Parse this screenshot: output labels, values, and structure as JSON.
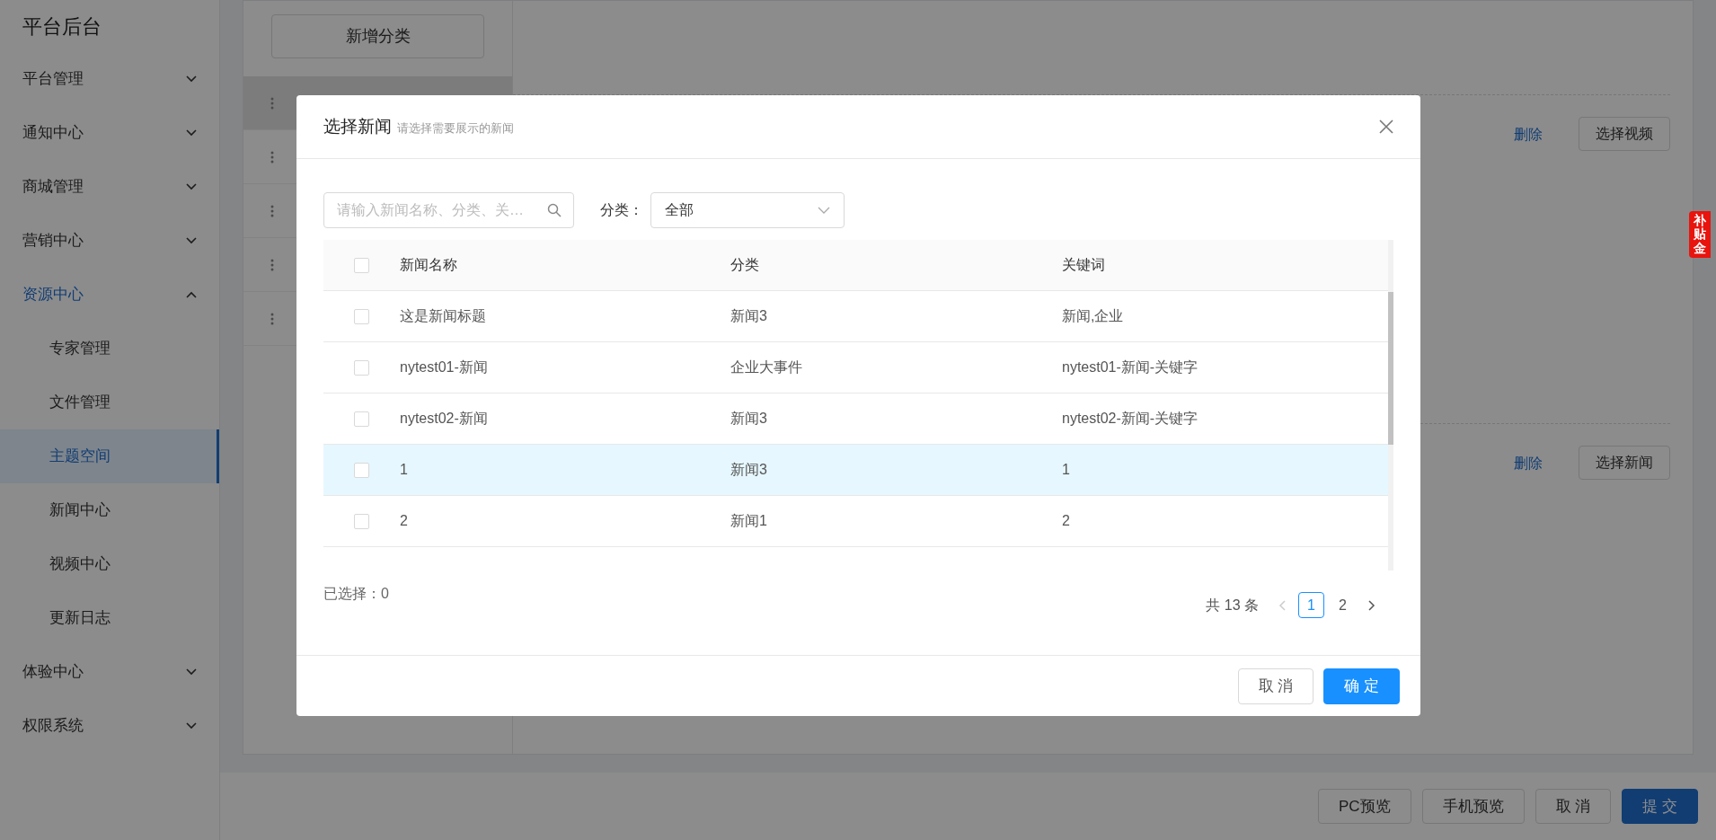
{
  "sidebar": {
    "title": "平台后台",
    "items": [
      {
        "label": "平台管理",
        "expanded": false
      },
      {
        "label": "通知中心",
        "expanded": false
      },
      {
        "label": "商城管理",
        "expanded": false
      },
      {
        "label": "营销中心",
        "expanded": false
      },
      {
        "label": "资源中心",
        "expanded": true,
        "children": [
          {
            "label": "专家管理",
            "selected": false
          },
          {
            "label": "文件管理",
            "selected": false
          },
          {
            "label": "主题空间",
            "selected": true
          },
          {
            "label": "新闻中心",
            "selected": false
          },
          {
            "label": "视频中心",
            "selected": false
          },
          {
            "label": "更新日志",
            "selected": false
          }
        ]
      },
      {
        "label": "体验中心",
        "expanded": false
      },
      {
        "label": "权限系统",
        "expanded": false
      }
    ]
  },
  "category_panel": {
    "add_button": "新增分类",
    "rows": [
      {
        "selected": true
      },
      {
        "selected": false
      },
      {
        "selected": false
      },
      {
        "selected": false
      },
      {
        "selected": false
      }
    ]
  },
  "content_sections": [
    {
      "delete_link": "删除",
      "select_button": "选择视频"
    },
    {
      "delete_link": "删除",
      "select_button": "选择新闻"
    }
  ],
  "footer_buttons": [
    {
      "label": "PC预览",
      "kind": "default"
    },
    {
      "label": "手机预览",
      "kind": "default"
    },
    {
      "label": "取 消",
      "kind": "default"
    },
    {
      "label": "提 交",
      "kind": "primary"
    }
  ],
  "floating_badge": "补贴金",
  "modal": {
    "title": "选择新闻",
    "subtitle": "请选择需要展示的新闻",
    "search": {
      "placeholder": "请输入新闻名称、分类、关…"
    },
    "filter": {
      "label": "分类：",
      "value": "全部"
    },
    "table": {
      "columns": [
        "新闻名称",
        "分类",
        "关键词"
      ],
      "header_checked": false,
      "rows": [
        {
          "cells": [
            "这是新闻标题",
            "新闻3",
            "新闻,企业"
          ],
          "checked": false,
          "highlighted": false
        },
        {
          "cells": [
            "nytest01-新闻",
            "企业大事件",
            "nytest01-新闻-关键字"
          ],
          "checked": false,
          "highlighted": false
        },
        {
          "cells": [
            "nytest02-新闻",
            "新闻3",
            "nytest02-新闻-关键字"
          ],
          "checked": false,
          "highlighted": false
        },
        {
          "cells": [
            "1",
            "新闻3",
            "1"
          ],
          "checked": false,
          "highlighted": true
        },
        {
          "cells": [
            "2",
            "新闻1",
            "2"
          ],
          "checked": false,
          "highlighted": false
        }
      ]
    },
    "selected_count": "已选择：0",
    "pagination": {
      "total": "共 13 条",
      "pages": [
        {
          "label": "1",
          "selected": true
        },
        {
          "label": "2",
          "selected": false
        }
      ]
    },
    "buttons": [
      {
        "label": "取 消",
        "kind": "default"
      },
      {
        "label": "确 定",
        "kind": "primary"
      }
    ]
  }
}
